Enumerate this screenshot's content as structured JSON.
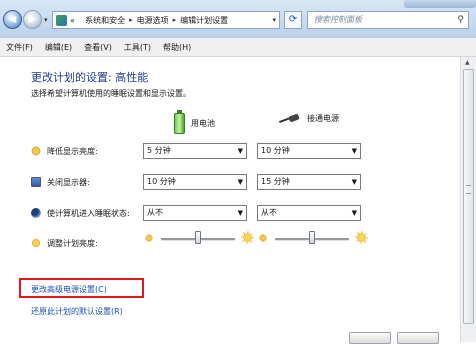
{
  "address_bar": {
    "back_glyph": "◀",
    "forward_glyph": "▶",
    "crumbs": [
      "系统和安全",
      "电源选项",
      "编辑计划设置"
    ],
    "lead_glyph": "«",
    "search_placeholder": "搜索控制面板"
  },
  "menu": [
    "文件(F)",
    "编辑(E)",
    "查看(V)",
    "工具(T)",
    "帮助(H)"
  ],
  "page": {
    "title": "更改计划的设置: 高性能",
    "subtitle": "选择希望计算机使用的睡眠设置和显示设置。",
    "columns": {
      "battery": "用电池",
      "plugged": "接通电源"
    },
    "rows": [
      {
        "label": "降低显示亮度:",
        "battery": "5 分钟",
        "plugged": "10 分钟",
        "icon": "brightness-icon"
      },
      {
        "label": "关闭显示器:",
        "battery": "10 分钟",
        "plugged": "15 分钟",
        "icon": "monitor-icon"
      },
      {
        "label": "使计算机进入睡眠状态:",
        "battery": "从不",
        "plugged": "从不",
        "icon": "sleep-icon"
      }
    ],
    "brightness_label": "调整计划亮度:",
    "brightness_battery": 0.5,
    "brightness_plugged": 0.5,
    "advanced_link": "更改高级电源设置(C)",
    "restore_link": "还原此计划的默认设置(R)"
  },
  "colors": {
    "title": "#1e3d8f",
    "link": "#1a4fb5",
    "highlight": "#e0191f"
  }
}
